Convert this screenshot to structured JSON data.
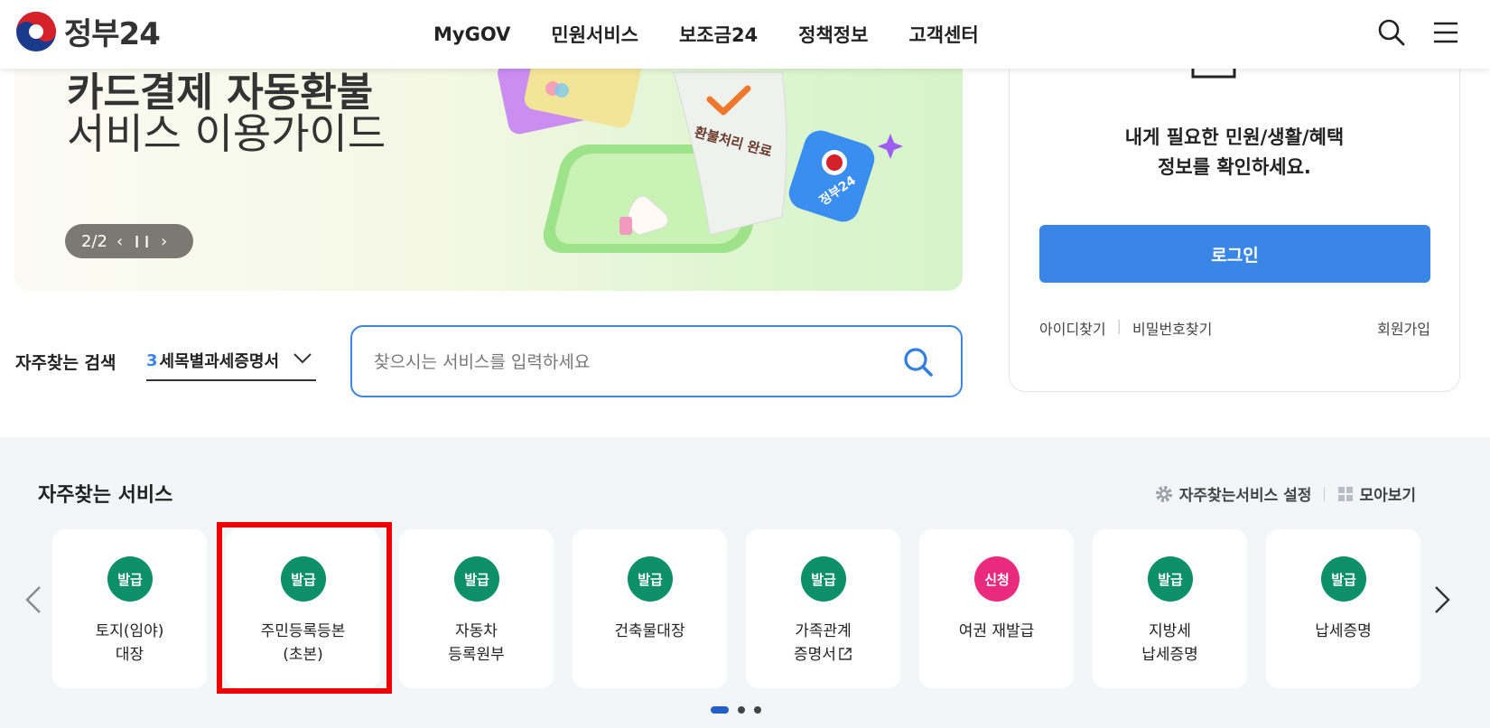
{
  "header": {
    "logo_text": "정부24",
    "nav": [
      "MyGOV",
      "민원서비스",
      "보조금24",
      "정책정보",
      "고객센터"
    ],
    "search_icon": "search-icon",
    "menu_icon": "hamburger-menu-icon"
  },
  "banner": {
    "title_line1": "카드결제 자동환불",
    "title_line2": "서비스 이용가이드",
    "page_indicator": "2/2",
    "prev_icon": "chevron-left-icon",
    "pause_icon": "pause-icon",
    "next_icon": "chevron-right-icon",
    "receipt_text": "환불처리 완료",
    "app_badge_text": "정부24"
  },
  "login": {
    "message_line1": "내게 필요한 민원/생활/혜택",
    "message_line2": "정보를 확인하세요.",
    "login_button": "로그인",
    "find_id": "아이디찾기",
    "find_password": "비밀번호찾기",
    "sign_up": "회원가입"
  },
  "search": {
    "label": "자주찾는 검색",
    "selected_rank": "3",
    "selected_term": "세목별과세증명서",
    "placeholder": "찾으시는 서비스를 입력하세요"
  },
  "frequent": {
    "title": "자주찾는 서비스",
    "settings_label": "자주찾는서비스 설정",
    "view_all_label": "모아보기",
    "cards": [
      {
        "badge": "발급",
        "name": "토지(임야)\n대장",
        "badge_color": "#0d8f6a"
      },
      {
        "badge": "발급",
        "name": "주민등록등본\n(초본)",
        "badge_color": "#0d8f6a"
      },
      {
        "badge": "발급",
        "name": "자동차\n등록원부",
        "badge_color": "#0d8f6a"
      },
      {
        "badge": "발급",
        "name": "건축물대장",
        "badge_color": "#0d8f6a"
      },
      {
        "badge": "발급",
        "name": "가족관계\n증명서",
        "badge_color": "#0d8f6a"
      },
      {
        "badge": "신청",
        "name": "여권 재발급",
        "badge_color": "#ea2b7d"
      },
      {
        "badge": "발급",
        "name": "지방세\n납세증명",
        "badge_color": "#0d8f6a"
      },
      {
        "badge": "발급",
        "name": "납세증명",
        "badge_color": "#0d8f6a"
      }
    ],
    "pagination_active": 1,
    "pagination_total": 3
  },
  "colors": {
    "accent": "#3a86e6",
    "badge_green": "#0d8f6a",
    "badge_pink": "#ea2b7d",
    "highlight": "#ee0000"
  }
}
